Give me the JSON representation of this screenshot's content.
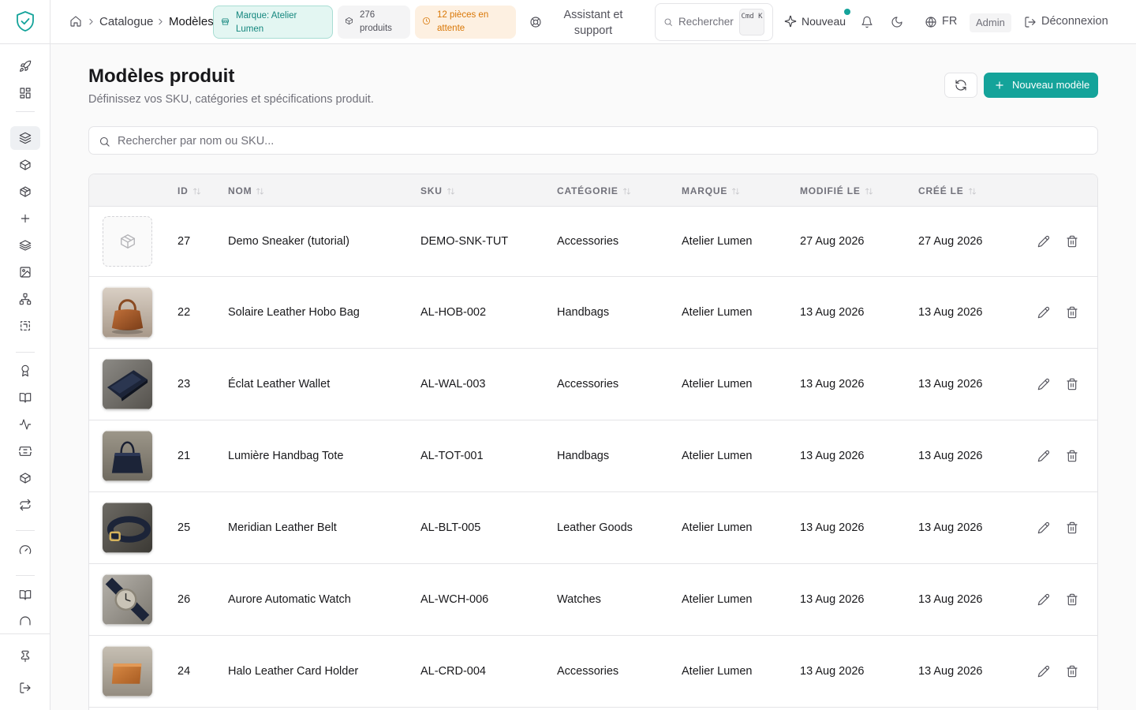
{
  "breadcrumb": {
    "home_icon": "home-icon",
    "items": [
      "Catalogue",
      "Modèles"
    ]
  },
  "chips": {
    "brand": "Marque: Atelier Lumen",
    "products": "276 produits",
    "pending": "12 pièces en attente"
  },
  "topbar": {
    "assistant": "Assistant et support",
    "search_label": "Rechercher",
    "search_kbd": "Cmd K",
    "new_label": "Nouveau",
    "language": "FR",
    "role": "Admin",
    "logout": "Déconnexion",
    "accent_color": "#14a39a"
  },
  "page": {
    "title": "Modèles produit",
    "subtitle": "Définissez vos SKU, catégories et spécifications produit.",
    "new_model": "Nouveau modèle",
    "search_placeholder": "Rechercher par nom ou SKU..."
  },
  "table": {
    "columns": [
      "ID",
      "NOM",
      "SKU",
      "CATÉGORIE",
      "MARQUE",
      "MODIFIÉ LE",
      "CRÉÉ LE"
    ],
    "rows": [
      {
        "id": "27",
        "name": "Demo Sneaker (tutorial)",
        "sku": "DEMO-SNK-TUT",
        "category": "Accessories",
        "brand": "Atelier Lumen",
        "modified": "27 Aug 2026",
        "created": "27 Aug 2026",
        "image": "placeholder-box"
      },
      {
        "id": "22",
        "name": "Solaire Leather Hobo Bag",
        "sku": "AL-HOB-002",
        "category": "Handbags",
        "brand": "Atelier Lumen",
        "modified": "13 Aug 2026",
        "created": "13 Aug 2026",
        "image": "hobo-bag"
      },
      {
        "id": "23",
        "name": "Éclat Leather Wallet",
        "sku": "AL-WAL-003",
        "category": "Accessories",
        "brand": "Atelier Lumen",
        "modified": "13 Aug 2026",
        "created": "13 Aug 2026",
        "image": "wallet"
      },
      {
        "id": "21",
        "name": "Lumière Handbag Tote",
        "sku": "AL-TOT-001",
        "category": "Handbags",
        "brand": "Atelier Lumen",
        "modified": "13 Aug 2026",
        "created": "13 Aug 2026",
        "image": "tote"
      },
      {
        "id": "25",
        "name": "Meridian Leather Belt",
        "sku": "AL-BLT-005",
        "category": "Leather Goods",
        "brand": "Atelier Lumen",
        "modified": "13 Aug 2026",
        "created": "13 Aug 2026",
        "image": "belt"
      },
      {
        "id": "26",
        "name": "Aurore Automatic Watch",
        "sku": "AL-WCH-006",
        "category": "Watches",
        "brand": "Atelier Lumen",
        "modified": "13 Aug 2026",
        "created": "13 Aug 2026",
        "image": "watch"
      },
      {
        "id": "24",
        "name": "Halo Leather Card Holder",
        "sku": "AL-CRD-004",
        "category": "Accessories",
        "brand": "Atelier Lumen",
        "modified": "13 Aug 2026",
        "created": "13 Aug 2026",
        "image": "card-holder"
      }
    ]
  }
}
